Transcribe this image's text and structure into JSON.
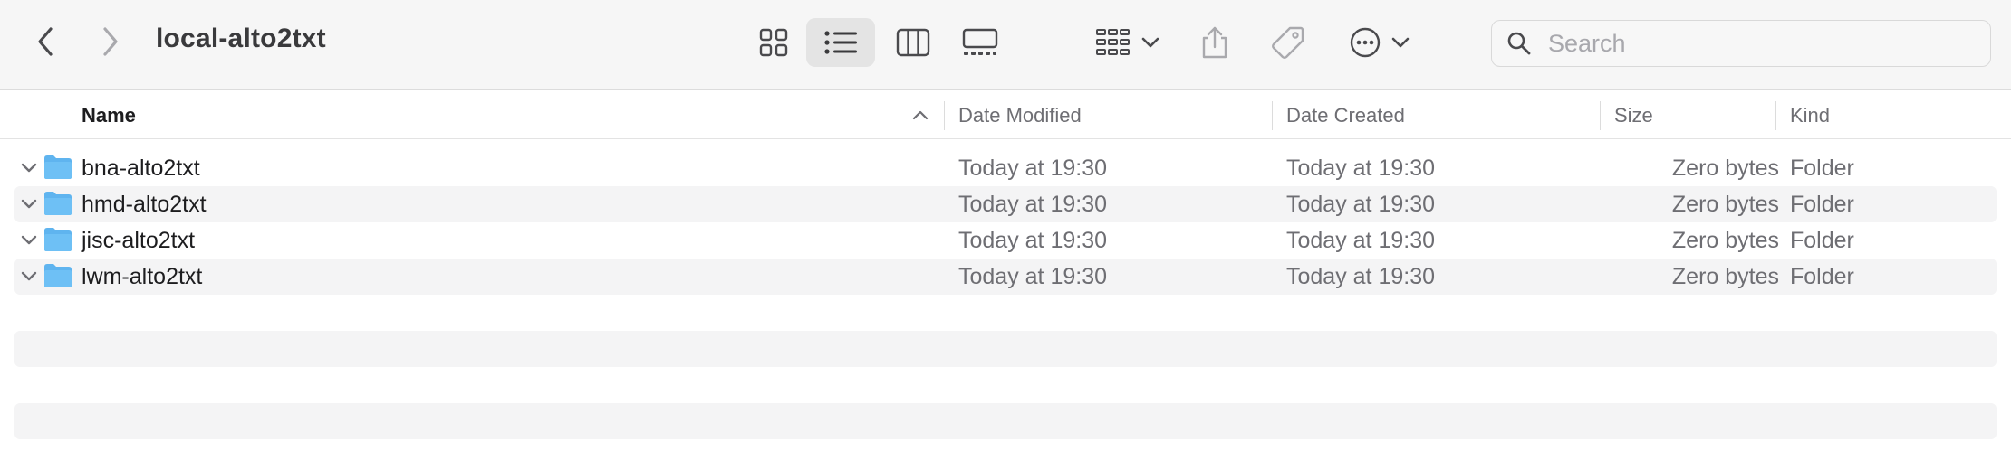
{
  "window": {
    "title": "local-alto2txt"
  },
  "toolbar": {
    "back_icon": "chevron-left-icon",
    "forward_icon": "chevron-right-icon",
    "view_modes": [
      "icon-view",
      "list-view",
      "column-view",
      "gallery-view"
    ],
    "active_view": "list-view",
    "group_icon": "group-grid-icon",
    "share_icon": "share-icon",
    "tag_icon": "tag-icon",
    "more_icon": "ellipsis-circle-icon"
  },
  "search": {
    "placeholder": "Search",
    "value": ""
  },
  "columns": {
    "name": "Name",
    "date_modified": "Date Modified",
    "date_created": "Date Created",
    "size": "Size",
    "kind": "Kind",
    "sorted_by": "Name",
    "sort_direction": "ascending"
  },
  "rows": [
    {
      "name": "bna-alto2txt",
      "date_modified": "Today at 19:30",
      "date_created": "Today at 19:30",
      "size": "Zero bytes",
      "kind": "Folder"
    },
    {
      "name": "hmd-alto2txt",
      "date_modified": "Today at 19:30",
      "date_created": "Today at 19:30",
      "size": "Zero bytes",
      "kind": "Folder"
    },
    {
      "name": "jisc-alto2txt",
      "date_modified": "Today at 19:30",
      "date_created": "Today at 19:30",
      "size": "Zero bytes",
      "kind": "Folder"
    },
    {
      "name": "lwm-alto2txt",
      "date_modified": "Today at 19:30",
      "date_created": "Today at 19:30",
      "size": "Zero bytes",
      "kind": "Folder"
    }
  ],
  "colors": {
    "accent_folder": "#5fb4ef",
    "toolbar_bg": "#f6f6f6",
    "stripe": "#f4f4f5"
  }
}
